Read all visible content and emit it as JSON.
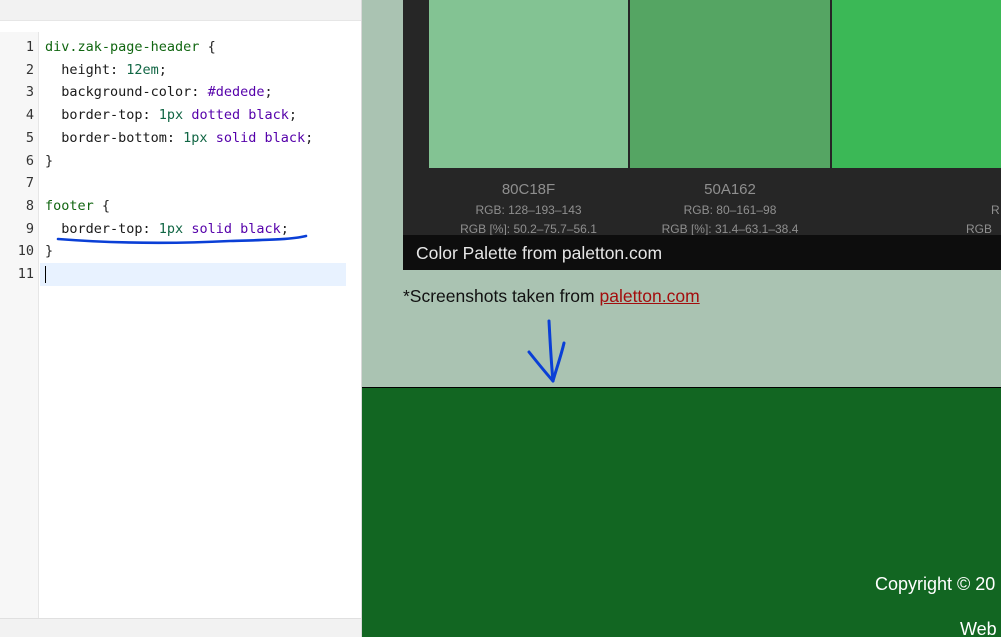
{
  "editor": {
    "line_numbers": [
      "1",
      "2",
      "3",
      "4",
      "5",
      "6",
      "7",
      "8",
      "9",
      "10",
      "11"
    ],
    "lines": [
      [
        {
          "t": "div.zak-page-header",
          "c": "c-sel"
        },
        {
          "t": " {",
          "c": "c-punc"
        }
      ],
      [
        {
          "t": "  height: ",
          "c": "c-prop"
        },
        {
          "t": "12em",
          "c": "c-num"
        },
        {
          "t": ";",
          "c": "c-punc"
        }
      ],
      [
        {
          "t": "  background-color: ",
          "c": "c-prop"
        },
        {
          "t": "#dedede",
          "c": "c-kw"
        },
        {
          "t": ";",
          "c": "c-punc"
        }
      ],
      [
        {
          "t": "  border-top: ",
          "c": "c-prop"
        },
        {
          "t": "1px",
          "c": "c-num"
        },
        {
          "t": " dotted black",
          "c": "c-kw"
        },
        {
          "t": ";",
          "c": "c-punc"
        }
      ],
      [
        {
          "t": "  border-bottom: ",
          "c": "c-prop"
        },
        {
          "t": "1px",
          "c": "c-num"
        },
        {
          "t": " solid black",
          "c": "c-kw"
        },
        {
          "t": ";",
          "c": "c-punc"
        }
      ],
      [
        {
          "t": "}",
          "c": "c-punc"
        }
      ],
      [],
      [
        {
          "t": "footer",
          "c": "c-sel"
        },
        {
          "t": " {",
          "c": "c-punc"
        }
      ],
      [
        {
          "t": "  border-top: ",
          "c": "c-prop"
        },
        {
          "t": "1px",
          "c": "c-num"
        },
        {
          "t": " solid black",
          "c": "c-kw"
        },
        {
          "t": ";",
          "c": "c-punc"
        }
      ],
      [
        {
          "t": "}",
          "c": "c-punc"
        }
      ],
      []
    ],
    "active_line": 11
  },
  "preview": {
    "swatches": [
      {
        "hex": "80C18F",
        "rgb": "RGB: 128–193–143",
        "rgb_pct": "RGB [%]: 50.2–75.7–56.1",
        "color": "#83c393"
      },
      {
        "hex": "50A162",
        "rgb": "RGB: 80–161–98",
        "rgb_pct": "RGB [%]: 31.4–63.1–38.4",
        "color": "#55a563"
      },
      {
        "hex": "",
        "rgb": "R",
        "rgb_pct": "RGB",
        "color": "#3bb856"
      }
    ],
    "caption": "Color Palette from paletton.com",
    "note_prefix": "*Screenshots taken from ",
    "note_link": "paletton.com",
    "footer": {
      "copyright": "Copyright © 20",
      "web": "Web"
    }
  },
  "colors": {
    "preview_bg": "#aac3b2",
    "footer_bg": "#126622",
    "annotation": "#0a3fd6"
  }
}
